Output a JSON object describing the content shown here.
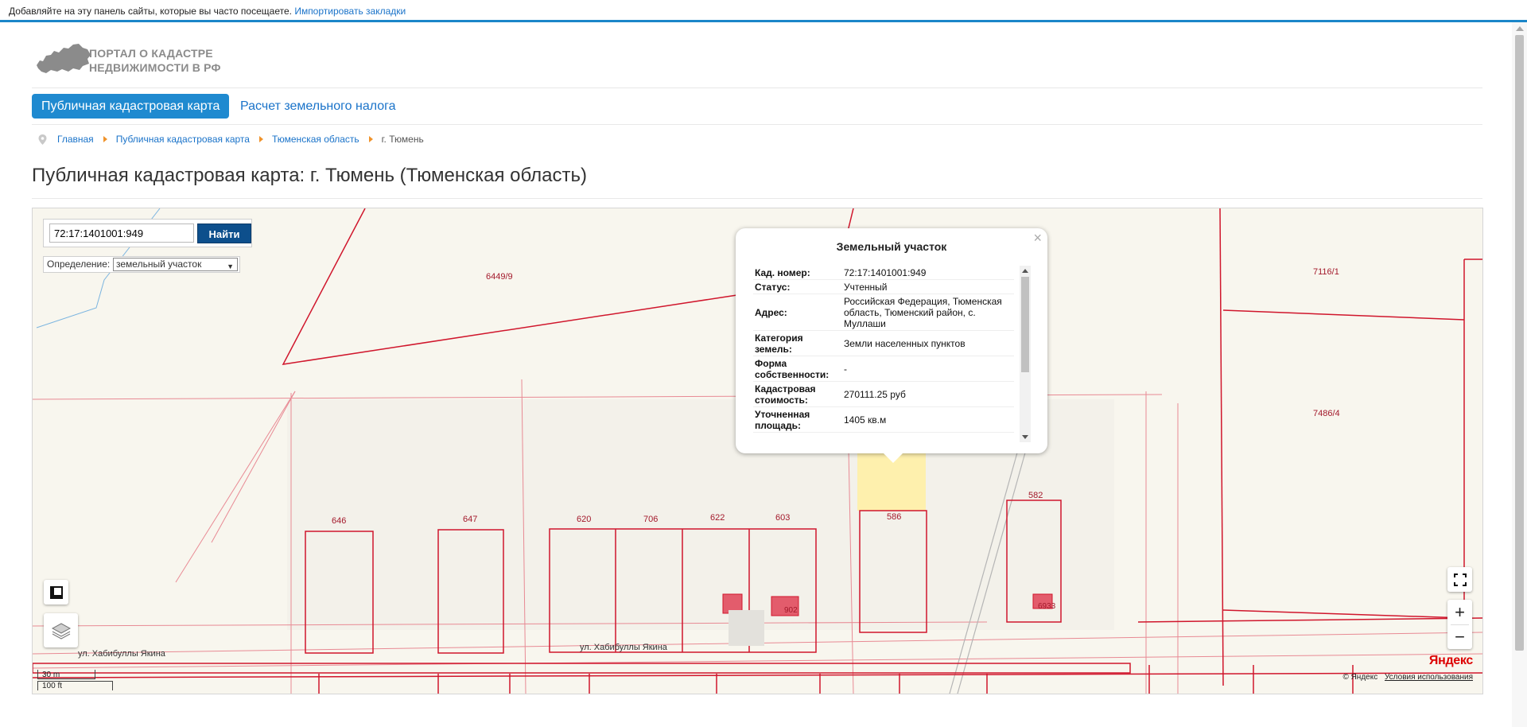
{
  "bookmarks_bar": {
    "text": "Добавляйте на эту панель сайты, которые вы часто посещаете.",
    "link": "Импортировать закладки"
  },
  "logo": {
    "line1": "ПОРТАЛ О КАДАСТРЕ",
    "line2": "НЕДВИЖИМОСТИ В РФ"
  },
  "nav": {
    "active": "Публичная кадастровая карта",
    "link": "Расчет земельного налога"
  },
  "breadcrumb": [
    "Главная",
    "Публичная кадастровая карта",
    "Тюменская область",
    "г. Тюмень"
  ],
  "page_title": "Публичная кадастровая карта: г. Тюмень (Тюменская область)",
  "search": {
    "value": "72:17:1401001:949",
    "button": "Найти",
    "definition_label": "Определение:",
    "definition_value": "земельный участок"
  },
  "popup": {
    "close": "×",
    "title": "Земельный участок",
    "rows": [
      {
        "key": "Кад. номер:",
        "value": "72:17:1401001:949"
      },
      {
        "key": "Статус:",
        "value": "Учтенный"
      },
      {
        "key": "Адрес:",
        "value": "Российская Федерация, Тюменская область, Тюменский район, с. Муллаши"
      },
      {
        "key": "Категория земель:",
        "value": "Земли населенных пунктов"
      },
      {
        "key": "Форма собственности:",
        "value": "-"
      },
      {
        "key": "Кадастровая стоимость:",
        "value": "270111.25 руб"
      },
      {
        "key": "Уточненная площадь:",
        "value": "1405 кв.м"
      }
    ]
  },
  "map": {
    "parcel_labels": [
      "6449/9",
      "7116/1",
      "7486/4",
      "646",
      "647",
      "620",
      "706",
      "622",
      "603",
      "586",
      "582",
      "902",
      "6933"
    ],
    "streets": [
      "ул. Хабибуллы Якина",
      "ул. Хабибуллы Якина"
    ],
    "scale": {
      "meters": "30 m",
      "feet": "100 ft"
    },
    "zoom_in": "+",
    "zoom_out": "−",
    "brand": "Яндекс",
    "copyright": "© Яндекс",
    "terms": "Условия использования"
  },
  "colors": {
    "accent": "#1f8ad0",
    "parcel_line": "#d0162c",
    "selected_parcel": "#fff3a8",
    "find_button": "#0d4f8c"
  }
}
